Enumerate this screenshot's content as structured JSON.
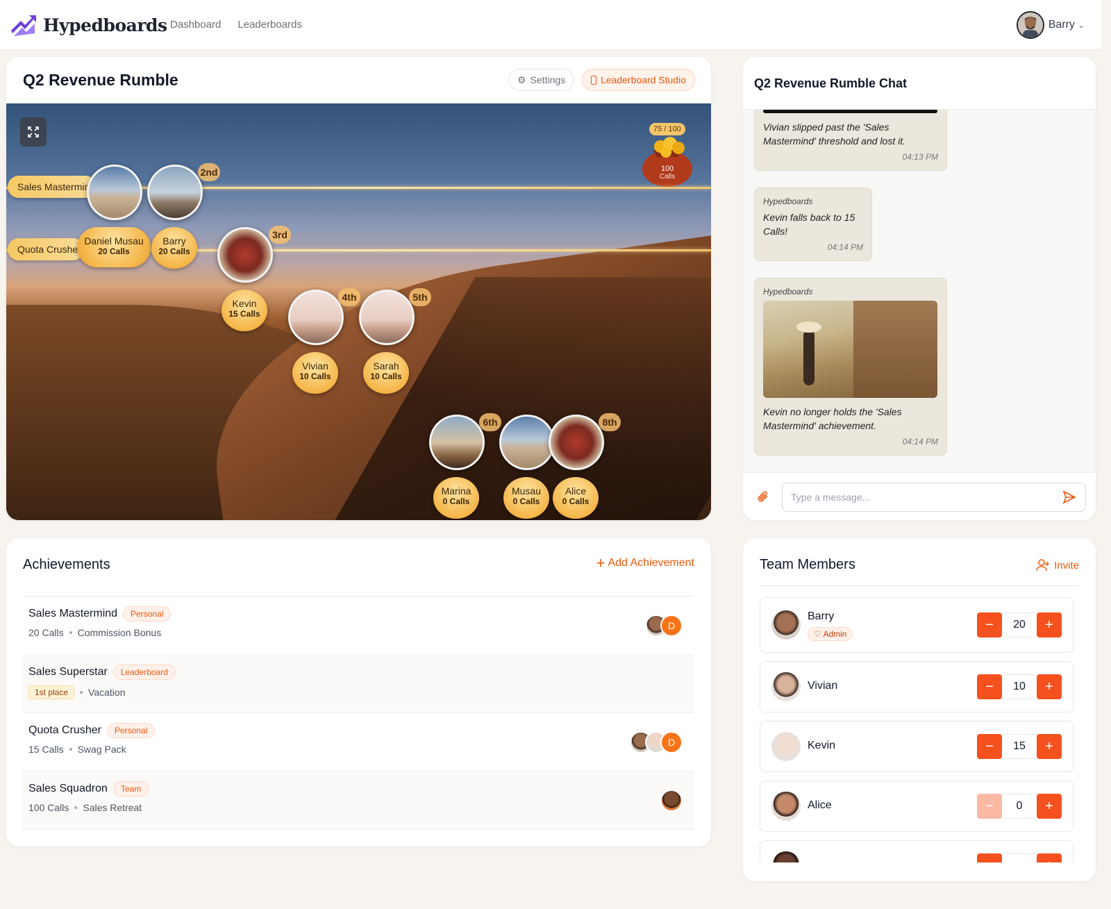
{
  "app": {
    "name": "Hypedboards"
  },
  "nav": {
    "links": [
      "Dashboard",
      "Leaderboards"
    ]
  },
  "user": {
    "name": "Barry"
  },
  "board": {
    "title": "Q2 Revenue Rumble",
    "settings_label": "Settings",
    "studio_label": "Leaderboard Studio",
    "goal": {
      "progress": "75 / 100",
      "amount": "100",
      "unit": "Calls"
    },
    "achievement_lines": [
      "Sales Mastermind",
      "Quota Crusher"
    ],
    "players": [
      {
        "name": "Daniel Musau",
        "calls": "20 Calls",
        "rank": ""
      },
      {
        "name": "Barry",
        "calls": "20 Calls",
        "rank": "2nd"
      },
      {
        "name": "Kevin",
        "calls": "15 Calls",
        "rank": "3rd"
      },
      {
        "name": "Vivian",
        "calls": "10 Calls",
        "rank": "4th"
      },
      {
        "name": "Sarah",
        "calls": "10 Calls",
        "rank": "5th"
      },
      {
        "name": "Marina",
        "calls": "0 Calls",
        "rank": "6th"
      },
      {
        "name": "Musau",
        "calls": "0 Calls",
        "rank": ""
      },
      {
        "name": "Alice",
        "calls": "0 Calls",
        "rank": "8th"
      }
    ]
  },
  "chat": {
    "title": "Q2 Revenue Rumble Chat",
    "messages": [
      {
        "sender": "",
        "text": "Vivian slipped past the 'Sales Mastermind' threshold and lost it.",
        "time": "04:13 PM"
      },
      {
        "sender": "Hypedboards",
        "text": "Kevin falls back to 15 Calls!",
        "time": "04:14 PM"
      },
      {
        "sender": "Hypedboards",
        "text": "Kevin no longer holds the 'Sales Mastermind' achievement.",
        "time": "04:14 PM"
      }
    ],
    "input_placeholder": "Type a message..."
  },
  "achievements": {
    "title": "Achievements",
    "add_label": "Add Achievement",
    "rows": [
      {
        "name": "Sales Mastermind",
        "type": "Personal",
        "goal": "20 Calls",
        "reward": "Commission Bonus"
      },
      {
        "name": "Sales Superstar",
        "type": "Leaderboard",
        "goal": "1st place",
        "reward": "Vacation"
      },
      {
        "name": "Quota Crusher",
        "type": "Personal",
        "goal": "15 Calls",
        "reward": "Swag Pack"
      },
      {
        "name": "Sales Squadron",
        "type": "Team",
        "goal": "100 Calls",
        "reward": "Sales Retreat"
      }
    ],
    "avatar_letter": "D"
  },
  "team": {
    "title": "Team Members",
    "invite_label": "Invite",
    "admin_label": "Admin",
    "members": [
      {
        "name": "Barry",
        "value": "20"
      },
      {
        "name": "Vivian",
        "value": "10"
      },
      {
        "name": "Kevin",
        "value": "15"
      },
      {
        "name": "Alice",
        "value": "0"
      }
    ]
  },
  "colors": {
    "accent": "#ea580c",
    "brand": "#6d3fd6",
    "gold": "#f5b649"
  }
}
